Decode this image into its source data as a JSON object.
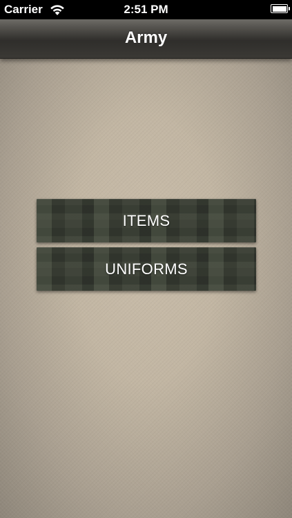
{
  "status_bar": {
    "carrier": "Carrier",
    "time": "2:51 PM",
    "wifi_icon": "wifi-icon",
    "battery_icon": "battery-icon",
    "battery_level": 1.0
  },
  "nav_bar": {
    "title": "Army"
  },
  "menu": {
    "buttons": [
      {
        "label": "ITEMS"
      },
      {
        "label": "UNIFORMS"
      }
    ]
  },
  "colors": {
    "background": "#c2b6a3",
    "nav_bar": "#3b3935",
    "button_camo": "#3a3e35",
    "text": "#ffffff"
  }
}
